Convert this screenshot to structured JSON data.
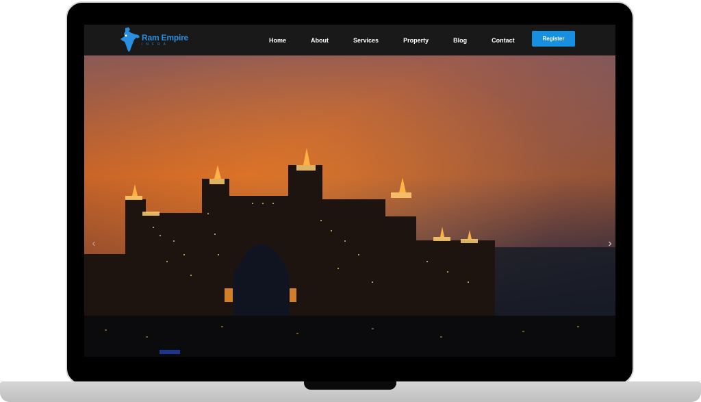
{
  "navbar": {
    "brand": "Ram Empire",
    "tagline": "INFRA",
    "links": [
      "Home",
      "About",
      "Services",
      "Property",
      "Blog",
      "Contact"
    ],
    "register_label": "Register"
  },
  "carousel": {
    "prev_icon": "‹",
    "next_icon": "›"
  },
  "colors": {
    "accent": "#1690df",
    "navbar_bg": "#191919",
    "brand": "#2a8fe0"
  }
}
